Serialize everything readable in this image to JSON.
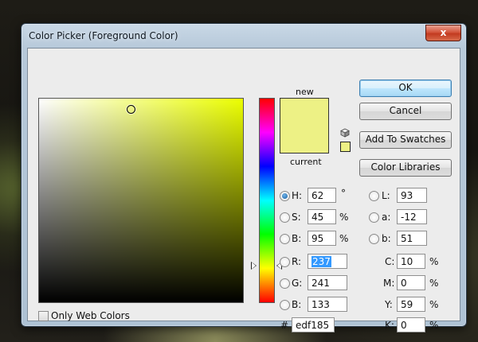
{
  "window": {
    "title": "Color Picker (Foreground Color)",
    "close_label": "x"
  },
  "preview": {
    "new_label": "new",
    "current_label": "current",
    "new_color": "#edf185",
    "current_color": "#edf185"
  },
  "marker_fraction": {
    "saturation": 0.45,
    "brightness": 0.95
  },
  "buttons": {
    "ok": "OK",
    "cancel": "Cancel",
    "add_to_swatches": "Add To Swatches",
    "color_libraries": "Color Libraries"
  },
  "hsb": {
    "h": {
      "label": "H:",
      "value": "62",
      "unit": "°"
    },
    "s": {
      "label": "S:",
      "value": "45",
      "unit": "%"
    },
    "b": {
      "label": "B:",
      "value": "95",
      "unit": "%"
    }
  },
  "lab": {
    "l": {
      "label": "L:",
      "value": "93"
    },
    "a": {
      "label": "a:",
      "value": "-12"
    },
    "b": {
      "label": "b:",
      "value": "51"
    }
  },
  "rgb": {
    "r": {
      "label": "R:",
      "value": "237"
    },
    "g": {
      "label": "G:",
      "value": "241"
    },
    "b": {
      "label": "B:",
      "value": "133"
    }
  },
  "cmyk": {
    "c": {
      "label": "C:",
      "value": "10",
      "unit": "%"
    },
    "m": {
      "label": "M:",
      "value": "0",
      "unit": "%"
    },
    "y": {
      "label": "Y:",
      "value": "59",
      "unit": "%"
    },
    "k": {
      "label": "K:",
      "value": "0",
      "unit": "%"
    }
  },
  "hex": {
    "label": "#",
    "value": "edf185"
  },
  "web_colors": {
    "label": "Only Web Colors"
  },
  "selected_mode": "H"
}
